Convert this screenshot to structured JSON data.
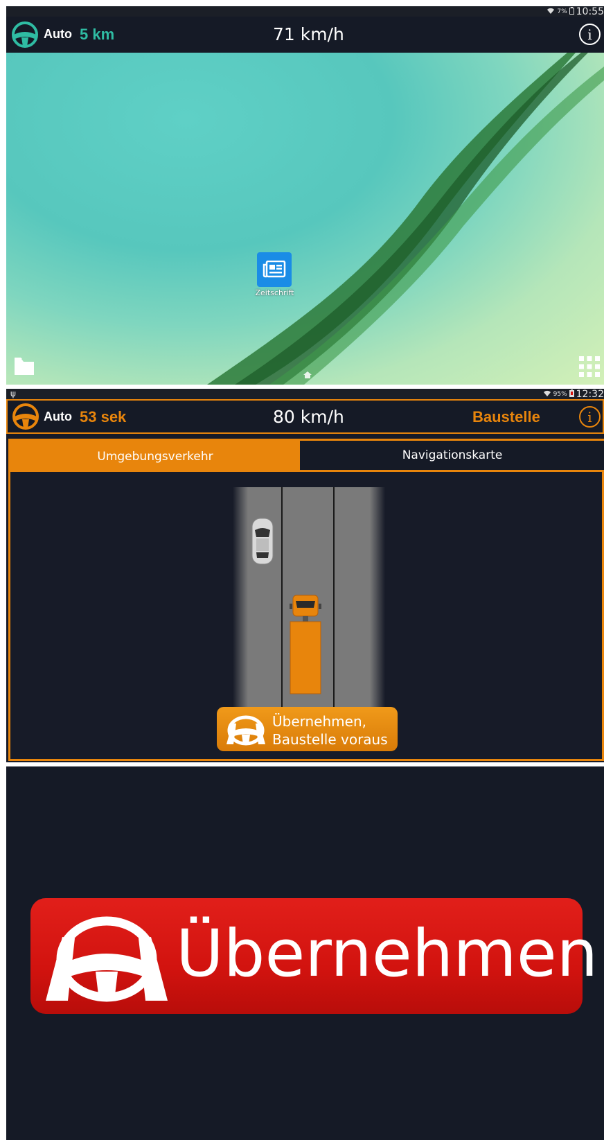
{
  "colors": {
    "teal": "#2fbca3",
    "orange": "#e8850c",
    "dark_bg": "#151a26",
    "alert_red": "#d8150f"
  },
  "panel1": {
    "status": {
      "battery": "7%",
      "time": "10:55",
      "icons": [
        "wifi-icon",
        "battery-icon"
      ]
    },
    "header": {
      "mode": "Auto",
      "distance": "5 km",
      "speed": "71 km/h",
      "info_icon": "info-icon"
    },
    "desktop": {
      "app_label": "Zeitschrift",
      "icons": [
        "folder-icon",
        "home-icon",
        "apps-grid-icon"
      ]
    }
  },
  "panel2": {
    "status": {
      "battery": "95%",
      "time": "12:32",
      "icons": [
        "usb-icon",
        "wifi-icon",
        "battery-icon"
      ]
    },
    "header": {
      "mode": "Auto",
      "countdown": "53 sek",
      "speed": "80 km/h",
      "alert": "Baustelle",
      "info_icon": "info-icon"
    },
    "tabs": [
      {
        "label": "Umgebungsverkehr",
        "active": true
      },
      {
        "label": "Navigationskarte",
        "active": false
      }
    ],
    "warning": {
      "line1": "Übernehmen,",
      "line2": "Baustelle voraus"
    }
  },
  "panel3": {
    "takeover": {
      "label": "Übernehmen!"
    }
  }
}
